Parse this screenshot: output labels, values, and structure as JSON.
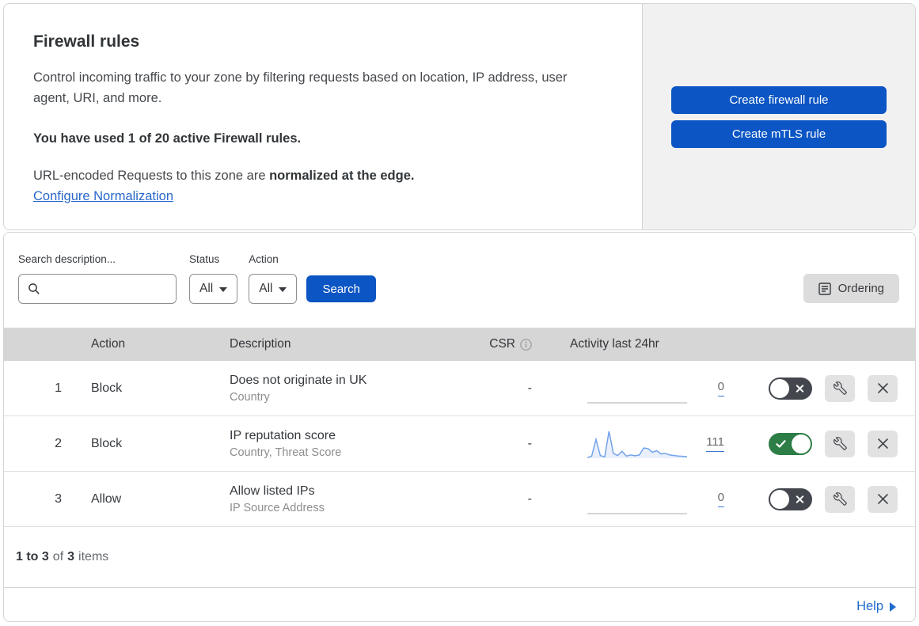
{
  "header": {
    "title": "Firewall rules",
    "description": "Control incoming traffic to your zone by filtering requests based on location, IP address, user agent, URI, and more.",
    "usage": "You have used 1 of 20 active Firewall rules.",
    "normalization_prefix": "URL-encoded Requests to this zone are ",
    "normalization_bold": "normalized at the edge.",
    "normalization_link": "Configure Normalization",
    "create_firewall_button": "Create firewall rule",
    "create_mtls_button": "Create mTLS rule"
  },
  "filters": {
    "search_label": "Search description...",
    "search_value": "",
    "status_label": "Status",
    "status_value": "All",
    "action_label": "Action",
    "action_value": "All",
    "search_button": "Search",
    "ordering_button": "Ordering"
  },
  "table": {
    "columns": {
      "action": "Action",
      "description": "Description",
      "csr": "CSR",
      "activity": "Activity last 24hr"
    },
    "rows": [
      {
        "priority": "1",
        "action": "Block",
        "description": "Does not originate in UK",
        "fields": "Country",
        "csr": "-",
        "activity_count": "0",
        "enabled": false,
        "sparkline": [
          0,
          0,
          0,
          0,
          0,
          0,
          0,
          0,
          0,
          0,
          0,
          0,
          0,
          0,
          0,
          0,
          0,
          0,
          0,
          0,
          0,
          0,
          0,
          0
        ]
      },
      {
        "priority": "2",
        "action": "Block",
        "description": "IP reputation score",
        "fields": "Country, Threat Score",
        "csr": "-",
        "activity_count": "111",
        "enabled": true,
        "sparkline": [
          2,
          8,
          70,
          10,
          5,
          100,
          18,
          10,
          26,
          8,
          12,
          9,
          12,
          38,
          36,
          22,
          28,
          16,
          18,
          12,
          10,
          8,
          7,
          6
        ]
      },
      {
        "priority": "3",
        "action": "Allow",
        "description": "Allow listed IPs",
        "fields": "IP Source Address",
        "csr": "-",
        "activity_count": "0",
        "enabled": false,
        "sparkline": [
          0,
          0,
          0,
          0,
          0,
          0,
          0,
          0,
          0,
          0,
          0,
          0,
          0,
          0,
          0,
          0,
          0,
          0,
          0,
          0,
          0,
          0,
          0,
          0
        ]
      }
    ]
  },
  "footer": {
    "range": "1 to 3",
    "of_word": "of",
    "total": "3",
    "items_word": "items",
    "help": "Help"
  },
  "colors": {
    "primary_blue": "#0b55c4",
    "link_blue": "#2767c9",
    "toggle_on_green": "#2d7d46",
    "toggle_off_gray": "#43474d",
    "sparkline_blue": "#74a3ea",
    "header_gray": "#d6d6d6",
    "panel_gray": "#f1f1f1"
  }
}
